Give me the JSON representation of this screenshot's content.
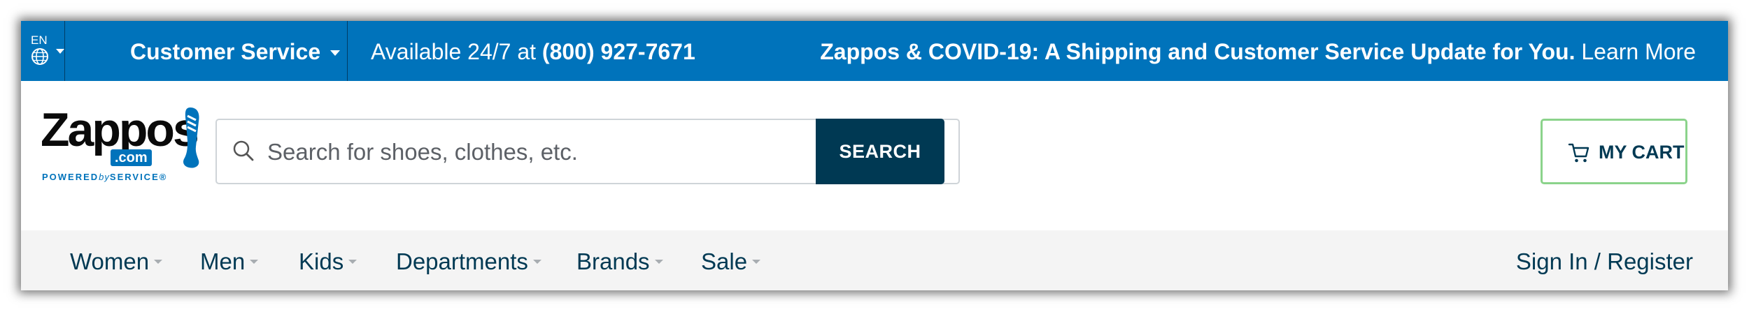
{
  "topbar": {
    "language": "EN",
    "customer_service": "Customer Service",
    "availability_prefix": "Available 24/7 at",
    "phone": "(800) 927-7671",
    "covid_message": "Zappos & COVID-19: A Shipping and Customer Service Update for You.",
    "learn_more": "Learn More",
    "bg_color": "#0073bb"
  },
  "header": {
    "logo": {
      "word": "Zappos",
      "com": ".com",
      "tagline_powered": "POWERED",
      "tagline_by": "by",
      "tagline_service": "SERVICE®"
    },
    "search": {
      "placeholder": "Search for shoes, clothes, etc.",
      "value": "",
      "button_label": "SEARCH",
      "icon": "search-icon"
    },
    "cart": {
      "label": "MY CART",
      "icon": "cart-icon",
      "border_color": "#8bd38b"
    }
  },
  "nav": {
    "items": [
      {
        "label": "Women"
      },
      {
        "label": "Men"
      },
      {
        "label": "Kids"
      },
      {
        "label": "Departments"
      },
      {
        "label": "Brands"
      },
      {
        "label": "Sale"
      }
    ],
    "sign_in": "Sign In / Register",
    "text_color": "#003953"
  }
}
